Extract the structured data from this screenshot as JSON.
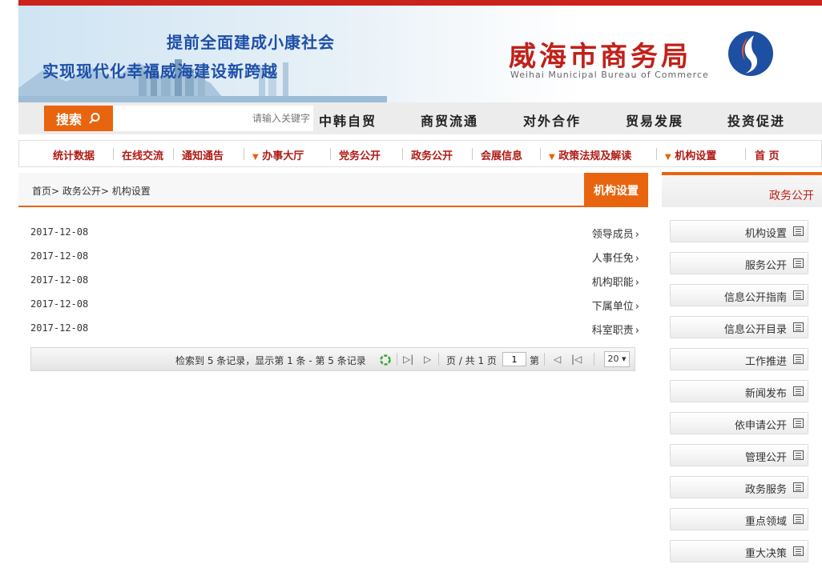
{
  "header": {
    "slogan_line1": "提前全面建成小康社会",
    "slogan_line2": "实现现代化幸福威海建设新跨越",
    "org_name": "威海市商务局",
    "org_name_en": "Weihai Municipal Bureau of Commerce"
  },
  "main_nav": {
    "search_button": "搜索",
    "search_placeholder": "请输入关键字",
    "items": [
      "中韩自贸",
      "商贸流通",
      "对外合作",
      "贸易发展",
      "投资促进"
    ]
  },
  "sub_nav": {
    "items": [
      "统计数据",
      "在线交流",
      "通知通告",
      "办事大厅",
      "党务公开",
      "政务公开",
      "会展信息",
      "政策法规及解读",
      "机构设置",
      "首 页"
    ],
    "dropdown_items": [
      "办事大厅",
      "政策法规及解读",
      "机构设置"
    ]
  },
  "content": {
    "breadcrumb": "首页> 政务公开> 机构设置",
    "tab_label": "机构设置",
    "rows": [
      {
        "title": "领导成员",
        "date": "2017-12-08"
      },
      {
        "title": "人事任免",
        "date": "2017-12-08"
      },
      {
        "title": "机构职能",
        "date": "2017-12-08"
      },
      {
        "title": "下属单位",
        "date": "2017-12-08"
      },
      {
        "title": "科室职责",
        "date": "2017-12-08"
      }
    ]
  },
  "pager": {
    "summary": "检索到 5 条记录，显示第 1 条 - 第 5 条记录",
    "page_prefix": "第",
    "page_value": "1",
    "page_suffix": "页 / 共 1 页",
    "page_size": "20 ▾"
  },
  "sidebar": {
    "title": "政务公开",
    "items": [
      "机构设置",
      "服务公开",
      "信息公开指南",
      "信息公开目录",
      "工作推进",
      "新闻发布",
      "依申请公开",
      "管理公开",
      "政务服务",
      "重点领域",
      "重大决策"
    ]
  },
  "colors": {
    "brand_red": "#c0211a",
    "accent_orange": "#e8640f",
    "slogan_blue": "#1e4fa8"
  },
  "icons": {
    "search": "search-icon",
    "logo": "bureau-logo-icon",
    "list_bullet": "chevron-right-icon",
    "sidebar_item": "list-icon",
    "refresh": "refresh-icon"
  }
}
